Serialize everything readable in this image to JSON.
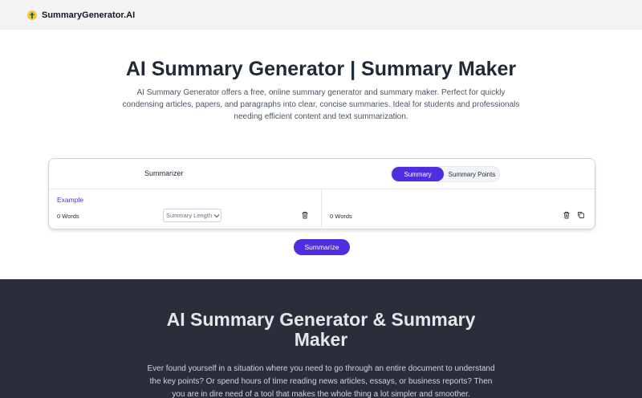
{
  "header": {
    "brand": "SummaryGenerator.AI",
    "logo_icon": "up-arrow-sun-icon"
  },
  "hero": {
    "title": "AI Summary Generator | Summary Maker",
    "description": "AI Summary Generator offers a free, online summary generator and summary maker. Perfect for quickly condensing articles, papers, and paragraphs into clear, concise summaries. Ideal for students and professionals needing efficient content and text summarization."
  },
  "tool": {
    "summarizer_label": "Summarizer",
    "modes": [
      "Summary",
      "Summary Points"
    ],
    "active_mode": "Summary",
    "example_label": "Example",
    "input_word_count": "0 Words",
    "length_placeholder": "Summary Length",
    "output_word_count": "0 Words",
    "summarize_label": "Summarize"
  },
  "section2": {
    "title": "AI Summary Generator & Summary Maker",
    "description": "Ever found yourself in a situation where you need to go through an entire document to understand the key points? Or spend hours of time reading news articles, essays, or business reports? Then you are in dire need of a tool that makes the whole thing a lot simpler and smoother."
  },
  "colors": {
    "accent": "#4f2ee0",
    "dark_bg": "#2a2e3b",
    "topbar_bg": "#f3f3f3"
  }
}
